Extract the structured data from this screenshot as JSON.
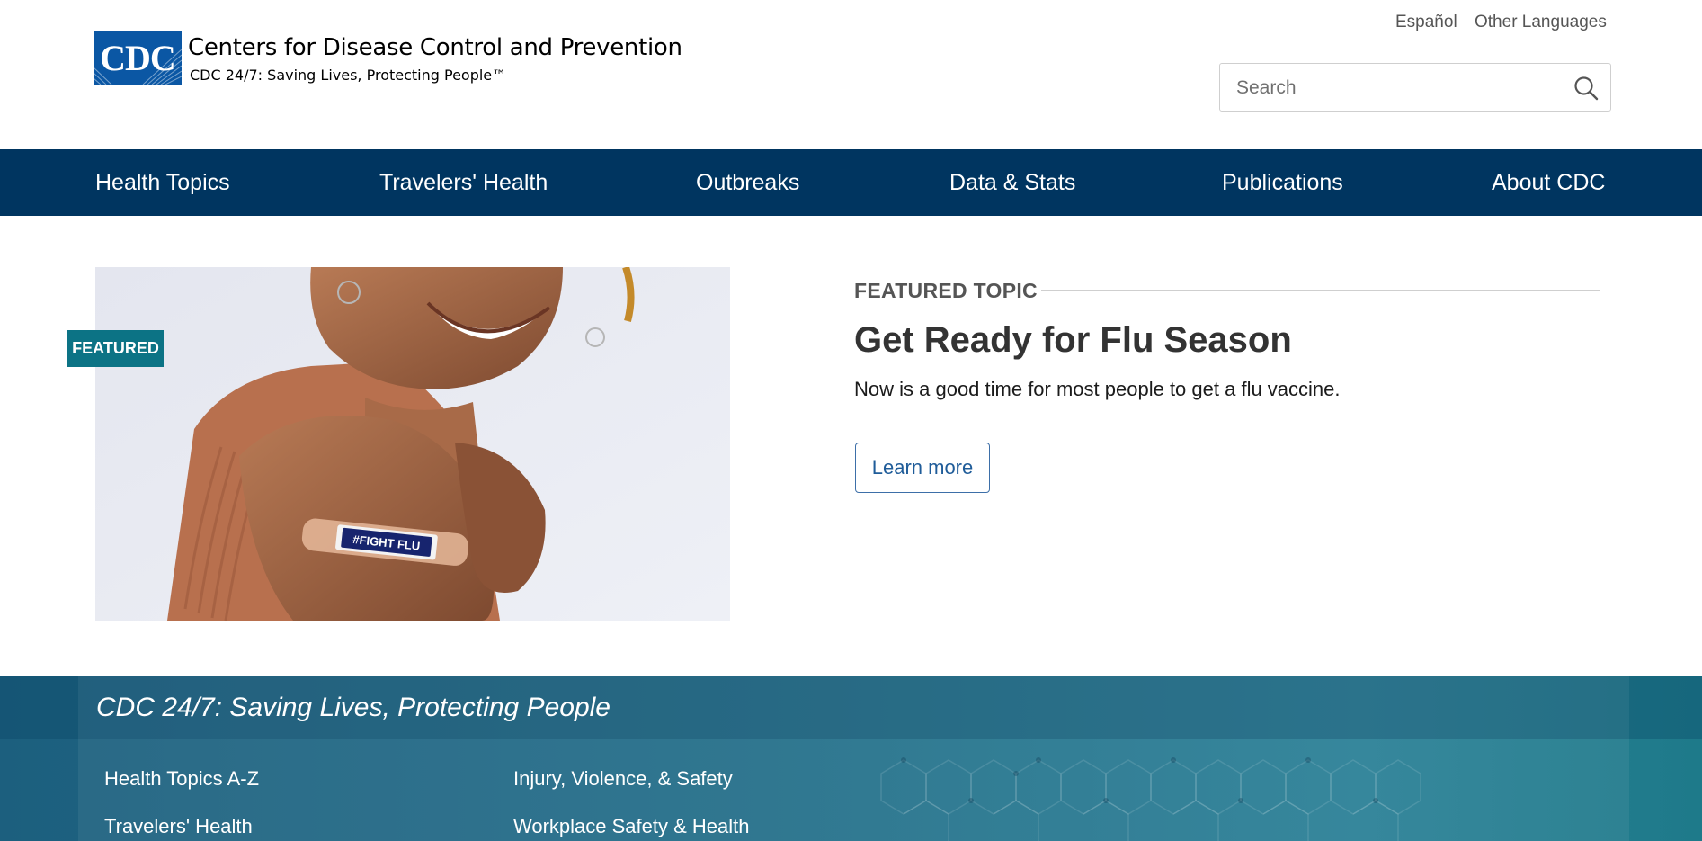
{
  "header": {
    "logo_text": "CDC",
    "org_name": "Centers for Disease Control and Prevention",
    "tagline": "CDC 24/7: Saving Lives, Protecting People™",
    "languages": [
      "Español",
      "Other Languages"
    ],
    "search": {
      "placeholder": "Search",
      "value": "",
      "icon": "search-icon"
    }
  },
  "nav": {
    "items": [
      "Health Topics",
      "Travelers' Health",
      "Outbreaks",
      "Data & Stats",
      "Publications",
      "About CDC"
    ]
  },
  "featured": {
    "badge": "FEATURED",
    "label": "FEATURED TOPIC",
    "title": "Get Ready for Flu Season",
    "description": "Now is a good time for most people to get a flu vaccine.",
    "button": "Learn more",
    "bandage_text": "#FIGHT FLU"
  },
  "footer": {
    "title": "CDC 24/7: Saving Lives, Protecting People",
    "links": [
      "Health Topics A-Z",
      "Injury, Violence, & Safety",
      "Travelers' Health",
      "Workplace Safety & Health"
    ]
  },
  "colors": {
    "nav_bg": "#003560",
    "badge_bg": "#0c7385",
    "logo_bg": "#0b57a4",
    "button_border": "#3d6fa8",
    "band_bg": "#246f8a"
  }
}
